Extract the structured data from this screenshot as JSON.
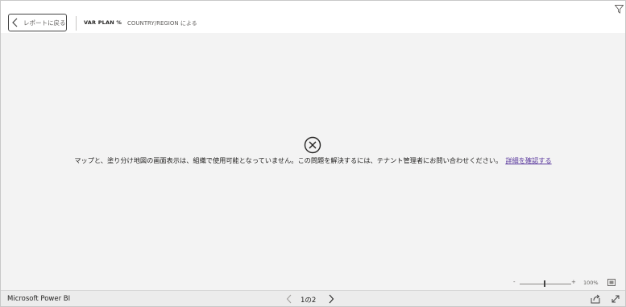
{
  "header": {
    "back_label": "レポートに戻る",
    "title": "VAR PLAN %",
    "subtitle": "COUNTRY/REGION による"
  },
  "canvas": {
    "error_message": "マップと、塗り分け地図の画面表示は、組織で使用可能となっていません。この問題を解決するには、テナント管理者にお問い合わせください。",
    "learn_more": "詳細を確認する"
  },
  "zoom": {
    "minus": "-",
    "plus": "+",
    "percent": "100%"
  },
  "footer": {
    "app_name": "Microsoft Power BI",
    "page_indicator": "1の2"
  },
  "colors": {
    "link": "#5b3a9e",
    "canvas_bg": "#f3f3f3"
  },
  "icons": [
    "chevron-left-icon",
    "filter-icon",
    "error-circle-x-icon",
    "fit-to-page-icon",
    "share-icon",
    "fullscreen-icon",
    "chevron-right-icon"
  ]
}
